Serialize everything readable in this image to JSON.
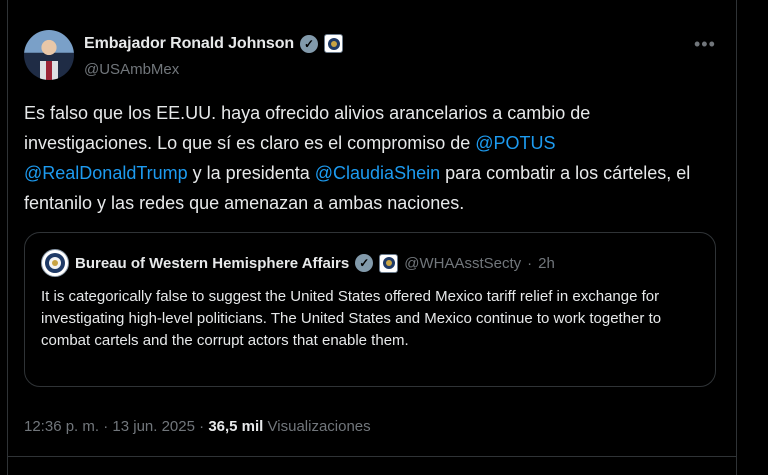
{
  "post": {
    "author_name": "Embajador Ronald Johnson",
    "author_handle": "@USAmbMex",
    "more_icon": "ellipsis-icon",
    "text_1": "Es falso que los EE.UU. haya ofrecido alivios arancelarios a cambio de investigaciones. Lo que sí es claro es el compromiso de ",
    "mention_1": "@POTUS",
    "text_2": " ",
    "mention_2": "@RealDonaldTrump",
    "text_3": " y la presidenta ",
    "mention_3": "@ClaudiaShein",
    "text_4": " para combatir a los cárteles, el fentanilo y las redes que amenazan a ambas naciones."
  },
  "quote": {
    "author_name": "Bureau of Western Hemisphere Affairs",
    "author_handle": "@WHAAsstSecty",
    "separator": "·",
    "time": "2h",
    "text": "It is categorically false to suggest the United States offered Mexico tariff relief in exchange for investigating high-level politicians. The United States and Mexico continue to work together to combat cartels and the corrupt actors that enable them."
  },
  "meta": {
    "time": "12:36 p. m.",
    "sep1": "·",
    "date": "13 jun. 2025",
    "sep2": "·",
    "views_count": "36,5 mil",
    "views_label": "Visualizaciones"
  },
  "colors": {
    "background": "#000000",
    "text": "#e7e9ea",
    "muted": "#71767b",
    "link": "#1d9bf0",
    "border": "#2f3336"
  }
}
